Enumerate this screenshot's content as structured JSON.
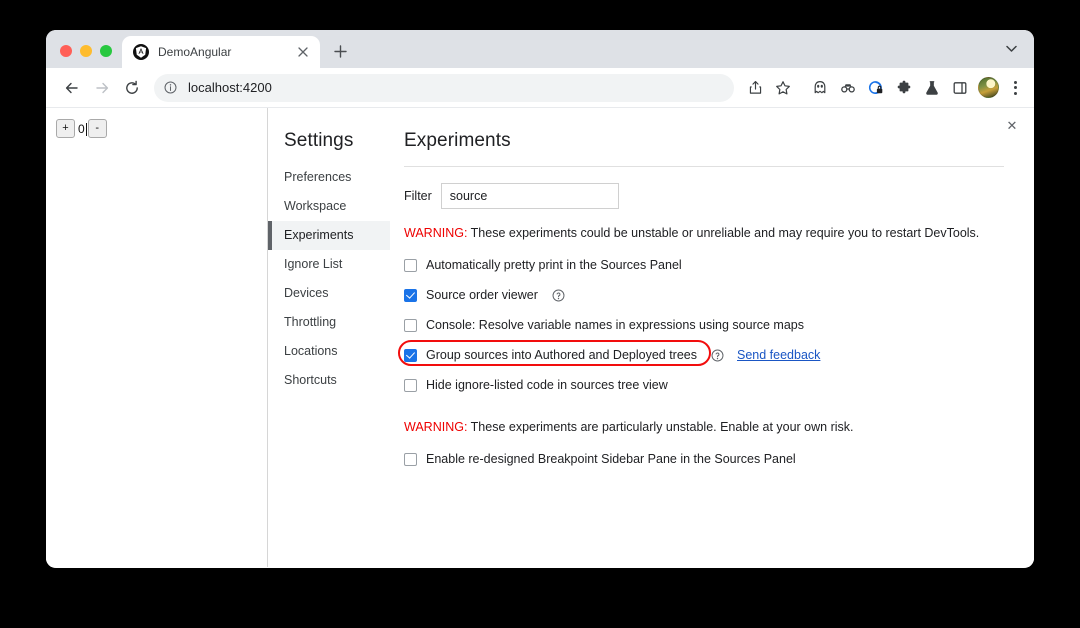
{
  "browser": {
    "traffic_lights": [
      "close",
      "minimize",
      "maximize"
    ],
    "tab": {
      "title": "DemoAngular",
      "favicon_name": "angular-logo-icon",
      "close_label": "×"
    },
    "new_tab_label": "+",
    "tab_search_name": "chevron-down-icon",
    "toolbar": {
      "back_name": "back-arrow-icon",
      "forward_name": "forward-arrow-icon",
      "reload_name": "reload-icon",
      "site_info_name": "info-circle-icon",
      "url": "localhost:4200",
      "url_placeholder": "Search Google or type a URL",
      "share_name": "share-icon",
      "bookmark_name": "star-icon",
      "extensions": [
        {
          "name": "ghost-extension-icon"
        },
        {
          "name": "incognito-goggles-extension-icon"
        },
        {
          "name": "privacy-shield-extension-icon"
        },
        {
          "name": "puzzle-piece-extensions-icon"
        },
        {
          "name": "flask-lab-extension-icon"
        },
        {
          "name": "side-panel-icon"
        }
      ],
      "avatar_name": "profile-avatar",
      "menu_name": "three-dot-menu-icon"
    }
  },
  "page": {
    "counter": {
      "increment_label": "+",
      "value": "0",
      "decrement_label": "-"
    }
  },
  "devtools": {
    "close_label": "✕",
    "settings_title": "Settings",
    "nav_items": [
      {
        "label": "Preferences",
        "selected": false
      },
      {
        "label": "Workspace",
        "selected": false
      },
      {
        "label": "Experiments",
        "selected": true
      },
      {
        "label": "Ignore List",
        "selected": false
      },
      {
        "label": "Devices",
        "selected": false
      },
      {
        "label": "Throttling",
        "selected": false
      },
      {
        "label": "Locations",
        "selected": false
      },
      {
        "label": "Shortcuts",
        "selected": false
      }
    ],
    "panel_title": "Experiments",
    "filter": {
      "label": "Filter",
      "value": "source",
      "placeholder": "Filter"
    },
    "warning_top": {
      "prefix": "WARNING:",
      "text": " These experiments could be unstable or unreliable and may require you to restart DevTools."
    },
    "experiments": [
      {
        "label": "Automatically pretty print in the Sources Panel",
        "checked": false,
        "help": false,
        "feedback": null,
        "highlighted": false
      },
      {
        "label": "Source order viewer",
        "checked": true,
        "help": true,
        "feedback": null,
        "highlighted": false
      },
      {
        "label": "Console: Resolve variable names in expressions using source maps",
        "checked": false,
        "help": false,
        "feedback": null,
        "highlighted": false
      },
      {
        "label": "Group sources into Authored and Deployed trees",
        "checked": true,
        "help": true,
        "feedback": "Send feedback",
        "highlighted": true
      },
      {
        "label": "Hide ignore-listed code in sources tree view",
        "checked": false,
        "help": false,
        "feedback": null,
        "highlighted": false
      }
    ],
    "warning_bottom": {
      "prefix": "WARNING:",
      "text": " These experiments are particularly unstable. Enable at your own risk."
    },
    "unstable_experiments": [
      {
        "label": "Enable re-designed Breakpoint Sidebar Pane in the Sources Panel",
        "checked": false,
        "help": false,
        "feedback": null,
        "highlighted": false
      }
    ]
  },
  "colors": {
    "accent_blue": "#1a73e8",
    "link_blue": "#1a56c4",
    "warning_red": "#ee0000",
    "highlight_red": "#f20d0d",
    "tabstrip_gray": "#dee1e6",
    "selected_nav_gray": "#f1f3f4"
  }
}
